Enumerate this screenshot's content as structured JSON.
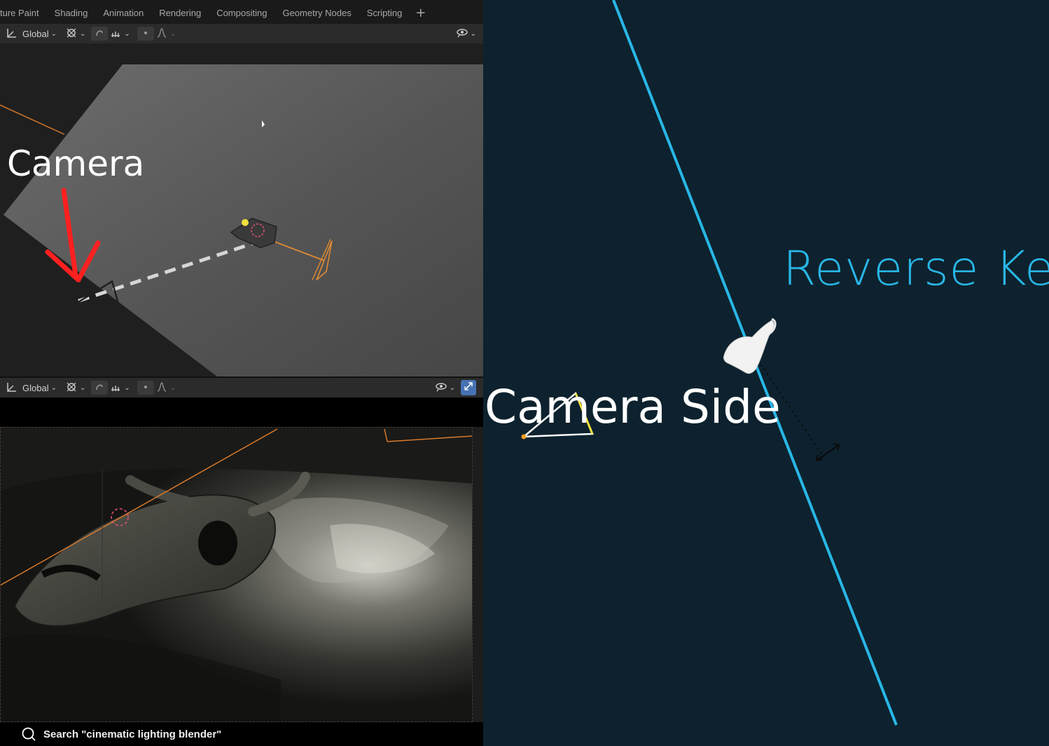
{
  "workspace_tabs": [
    "ture Paint",
    "Shading",
    "Animation",
    "Rendering",
    "Compositing",
    "Geometry Nodes",
    "Scripting"
  ],
  "workspace_add": "+",
  "header_top": {
    "orientation": "Global"
  },
  "header_bottom": {
    "orientation": "Global"
  },
  "viewport_annotation": "Camera",
  "search_bar": {
    "text": "Search \"cinematic lighting blender\""
  },
  "diagram": {
    "key_label": "Reverse Key",
    "camera_label": "Camera Side",
    "line_color": "#29b6e6",
    "background_color": "#0d222e"
  },
  "icons": [
    "transform-orientation-icon",
    "pivot-icon",
    "snap-icon",
    "snap-target-icon",
    "proportional-edit-icon",
    "falloff-icon",
    "visibility-icon",
    "gizmo-icon",
    "search-icon",
    "red-arrow-icon"
  ]
}
